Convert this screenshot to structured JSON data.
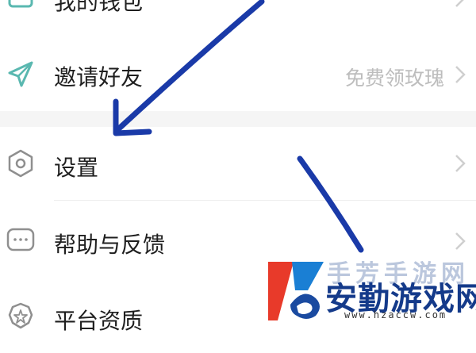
{
  "menu": {
    "items": [
      {
        "label": "我的钱包",
        "icon": "wallet-icon"
      },
      {
        "label": "邀请好友",
        "value": "免费领玫瑰",
        "icon": "paper-plane-icon"
      },
      {
        "label": "设置",
        "icon": "hexagon-gear-icon"
      },
      {
        "label": "帮助与反馈",
        "icon": "chat-bubble-icon"
      },
      {
        "label": "平台资质",
        "icon": "badge-icon"
      }
    ]
  },
  "watermark": {
    "brand": "安勤游戏网",
    "faint_text": "手芳手游网",
    "url": "www.hzaccw.com",
    "logo": "brand-logo-icon"
  },
  "colors": {
    "accent_teal": "#5ab8b0",
    "annotation_arrow": "#1a3aa8",
    "text_primary": "#1f1f1f",
    "text_secondary": "#bdbdbd",
    "section_gap": "#f5f5f5",
    "watermark_blue": "#143a8a",
    "watermark_red": "#e83a2a"
  }
}
